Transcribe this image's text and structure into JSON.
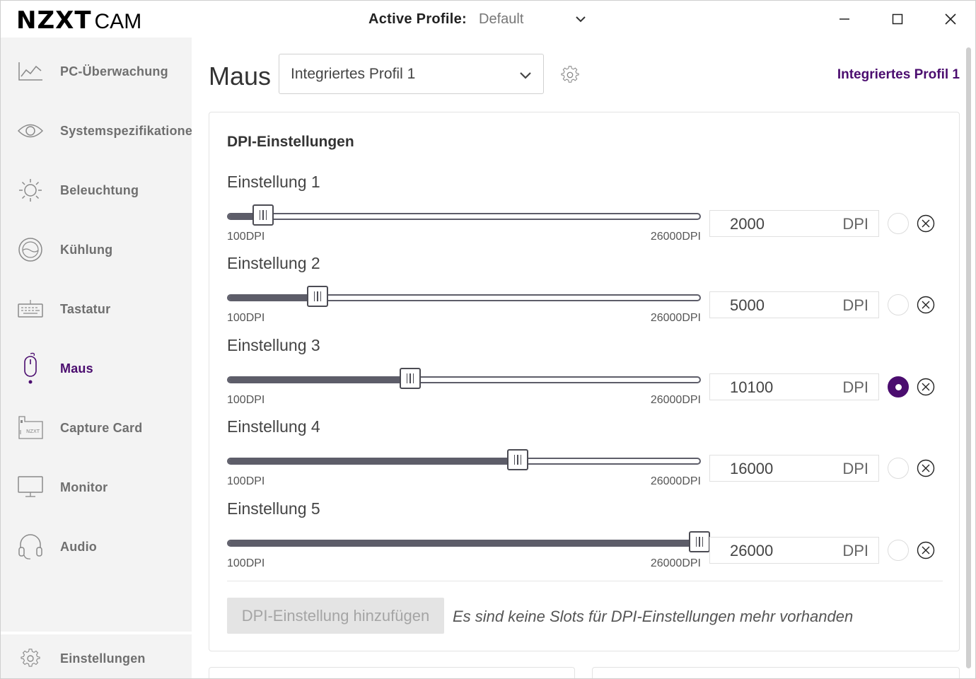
{
  "app": {
    "logo_main": "NZXT",
    "logo_sub": "CAM",
    "active_profile_label": "Active Profile:",
    "active_profile_value": "Default"
  },
  "sidebar": {
    "items": [
      {
        "label": "PC-Überwachung",
        "icon": "chart-line-icon",
        "active": false
      },
      {
        "label": "Systemspezifikationen",
        "icon": "eye-icon",
        "active": false
      },
      {
        "label": "Beleuchtung",
        "icon": "sun-icon",
        "active": false
      },
      {
        "label": "Kühlung",
        "icon": "cooling-icon",
        "active": false
      },
      {
        "label": "Tastatur",
        "icon": "keyboard-icon",
        "active": false
      },
      {
        "label": "Maus",
        "icon": "mouse-icon",
        "active": true
      },
      {
        "label": "Capture Card",
        "icon": "capture-card-icon",
        "active": false
      },
      {
        "label": "Monitor",
        "icon": "monitor-icon",
        "active": false
      },
      {
        "label": "Audio",
        "icon": "headset-icon",
        "active": false
      }
    ],
    "settings_label": "Einstellungen",
    "capture_card_icon_text": "NZXT"
  },
  "main": {
    "title": "Maus",
    "profile_select_value": "Integriertes Profil 1",
    "profile_link": "Integriertes Profil 1"
  },
  "dpi": {
    "section_title": "DPI-Einstellungen",
    "min_label": "100DPI",
    "max_label": "26000DPI",
    "min": 100,
    "max": 26000,
    "unit": "DPI",
    "settings": [
      {
        "label": "Einstellung 1",
        "value": "2000",
        "selected": false
      },
      {
        "label": "Einstellung 2",
        "value": "5000",
        "selected": false
      },
      {
        "label": "Einstellung 3",
        "value": "10100",
        "selected": true
      },
      {
        "label": "Einstellung 4",
        "value": "16000",
        "selected": false
      },
      {
        "label": "Einstellung 5",
        "value": "26000",
        "selected": false
      }
    ],
    "add_button": "DPI-Einstellung hinzufügen",
    "no_slots_message": "Es sind keine Slots für DPI-Einstellungen mehr vorhanden"
  },
  "colors": {
    "accent": "#4b0d6f",
    "slider": "#5d5d69",
    "sidebar_bg": "#f3f3f3"
  }
}
